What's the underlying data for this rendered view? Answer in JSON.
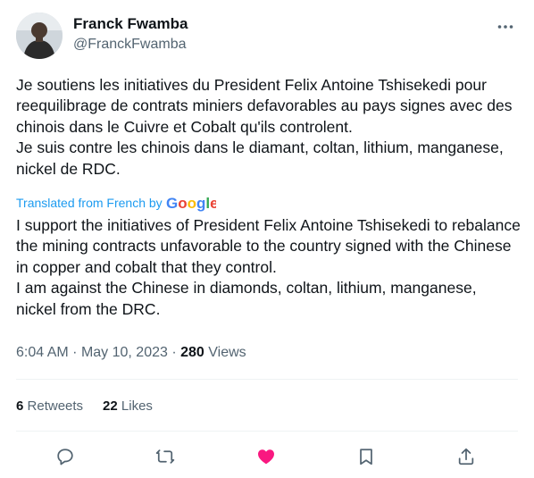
{
  "author": {
    "display_name": "Franck Fwamba",
    "handle": "@FranckFwamba"
  },
  "tweet": {
    "text": "Je soutiens les initiatives du President Felix Antoine Tshisekedi pour reequilibrage de contrats miniers defavorables au pays signes avec des chinois dans le Cuivre et Cobalt qu'ils controlent.\nJe suis contre les chinois dans le diamant, coltan, lithium, manganese, nickel de RDC.",
    "translated_label": "Translated from French by",
    "translation": "I support the initiatives of President Felix Antoine Tshisekedi to rebalance the mining contracts unfavorable to the country signed with the Chinese in copper and cobalt that they control.\nI am against the Chinese in diamonds, coltan, lithium, manganese, nickel from the DRC.",
    "time": "6:04 AM",
    "date": "May 10, 2023",
    "views_count": "280",
    "views_label": "Views"
  },
  "stats": {
    "retweets_count": "6",
    "retweets_label": "Retweets",
    "likes_count": "22",
    "likes_label": "Likes"
  },
  "icons": {
    "more": "more-icon",
    "reply": "reply-icon",
    "retweet": "retweet-icon",
    "like": "heart-filled-icon",
    "bookmark": "bookmark-icon",
    "share": "share-icon"
  },
  "colors": {
    "text": "#0f1419",
    "secondary": "#536471",
    "link": "#1d9bf0",
    "like": "#f91880",
    "divider": "#eff3f4"
  }
}
